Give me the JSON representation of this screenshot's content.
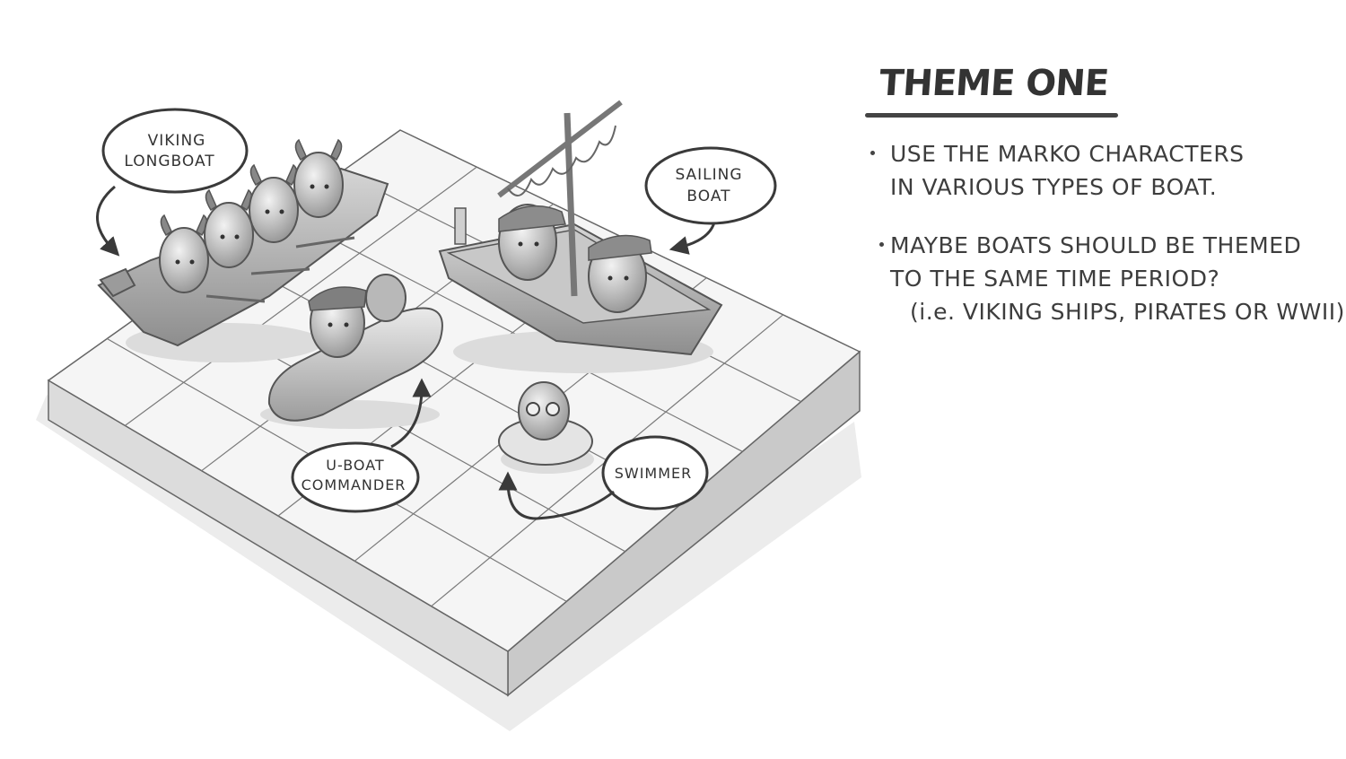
{
  "callouts": {
    "viking": [
      "VIKING",
      "LONGBOAT"
    ],
    "sailing": [
      "SAILING",
      "BOAT"
    ],
    "uboat": [
      "U-BOAT",
      "COMMANDER"
    ],
    "swimmer": [
      "SWIMMER"
    ]
  },
  "notes": {
    "title": "THEME ONE",
    "bullet1": [
      "USE THE MARKO CHARACTERS",
      "IN VARIOUS TYPES OF BOAT."
    ],
    "bullet2": [
      "MAYBE BOATS SHOULD BE THEMED",
      "TO THE SAME TIME PERIOD?",
      "(i.e. VIKING SHIPS, PIRATES OR WWII)"
    ]
  },
  "colors": {
    "ink": "#333333",
    "board_top": "#f4f4f4",
    "board_front": "#d9d9d9",
    "board_side": "#c7c7c7",
    "shadow": "#e6e6e6"
  }
}
